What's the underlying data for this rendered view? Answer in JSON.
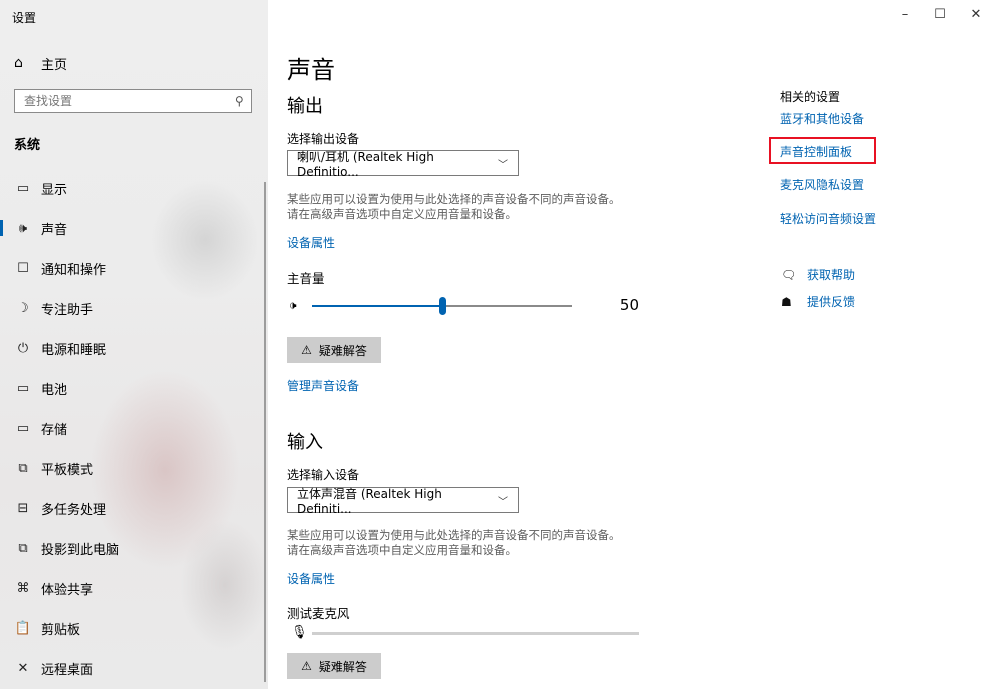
{
  "window": {
    "title": "设置",
    "controls": {
      "minimize": "–",
      "maximize": "☐",
      "close": "✕"
    }
  },
  "sidebar": {
    "home_label": "主页",
    "search_placeholder": "查找设置",
    "section": "系统",
    "items": [
      {
        "icon": "display-icon",
        "glyph": "▭",
        "label": "显示"
      },
      {
        "icon": "speaker-icon",
        "glyph": "🕪",
        "label": "声音",
        "active": true
      },
      {
        "icon": "notification-icon",
        "glyph": "☐",
        "label": "通知和操作"
      },
      {
        "icon": "moon-icon",
        "glyph": "☽",
        "label": "专注助手"
      },
      {
        "icon": "power-icon",
        "glyph": "⏻",
        "label": "电源和睡眠"
      },
      {
        "icon": "battery-icon",
        "glyph": "▭",
        "label": "电池"
      },
      {
        "icon": "storage-icon",
        "glyph": "▭",
        "label": "存储"
      },
      {
        "icon": "tablet-icon",
        "glyph": "⧉",
        "label": "平板模式"
      },
      {
        "icon": "multitask-icon",
        "glyph": "⊟",
        "label": "多任务处理"
      },
      {
        "icon": "project-icon",
        "glyph": "⧉",
        "label": "投影到此电脑"
      },
      {
        "icon": "share-icon",
        "glyph": "⌘",
        "label": "体验共享"
      },
      {
        "icon": "clipboard-icon",
        "glyph": "📋",
        "label": "剪贴板"
      },
      {
        "icon": "remote-icon",
        "glyph": "✕",
        "label": "远程桌面"
      }
    ]
  },
  "main": {
    "title": "声音",
    "output": {
      "heading": "输出",
      "device_label": "选择输出设备",
      "device_value": "喇叭/耳机 (Realtek High Definitio...",
      "desc_line1": "某些应用可以设置为使用与此处选择的声音设备不同的声音设备。",
      "desc_line2": "请在高级声音选项中自定义应用音量和设备。",
      "properties_link": "设备属性",
      "volume_label": "主音量",
      "volume": 50,
      "troubleshoot": "疑难解答",
      "manage_link": "管理声音设备"
    },
    "input": {
      "heading": "输入",
      "device_label": "选择输入设备",
      "device_value": "立体声混音 (Realtek High Definiti...",
      "desc_line1": "某些应用可以设置为使用与此处选择的声音设备不同的声音设备。",
      "desc_line2": "请在高级声音选项中自定义应用音量和设备。",
      "properties_link": "设备属性",
      "test_mic_label": "测试麦克风",
      "troubleshoot": "疑难解答"
    }
  },
  "related": {
    "title": "相关的设置",
    "links": [
      "蓝牙和其他设备",
      "声音控制面板",
      "麦克风隐私设置",
      "轻松访问音频设置"
    ],
    "help": "获取帮助",
    "feedback": "提供反馈"
  },
  "colors": {
    "accent": "#0063b1",
    "highlight": "#e81123"
  }
}
